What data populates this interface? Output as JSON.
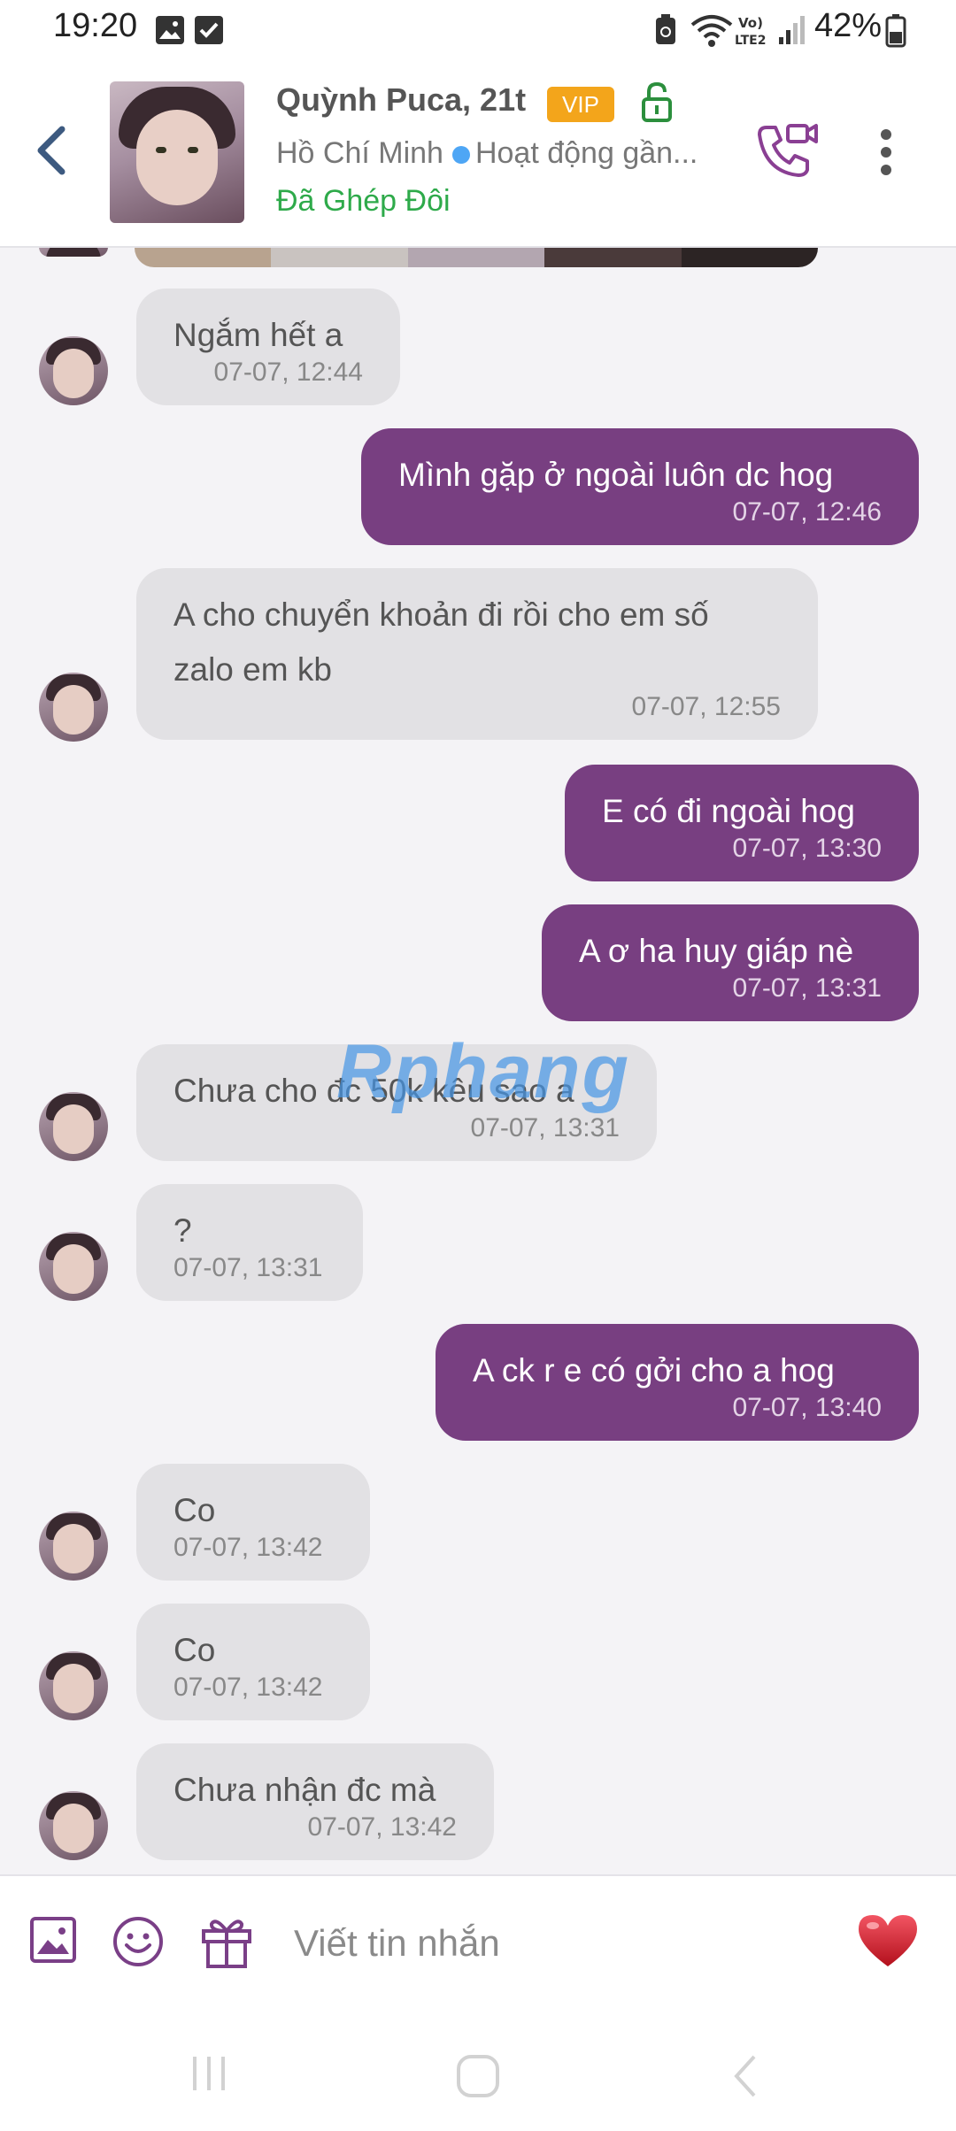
{
  "status_bar": {
    "time": "19:20",
    "battery": "42%",
    "icons": [
      "image-icon",
      "checkbox-icon",
      "recycle-icon",
      "wifi-icon",
      "volte-icon",
      "signal-icon",
      "battery-icon"
    ]
  },
  "header": {
    "name": "Quỳnh Puca, 21t",
    "badge": "VIP",
    "location": "Hồ Chí Minh",
    "activity": "Hoạt động gần...",
    "match_status": "Đã Ghép Đôi",
    "colors": {
      "accent": "#783f81",
      "vip": "#f3a51b",
      "matched": "#2eaa4a",
      "online": "#4ea6f5"
    }
  },
  "messages": [
    {
      "side": "in",
      "text": "Ngắm hết a",
      "time": "07-07, 12:44"
    },
    {
      "side": "out",
      "text": "Mình gặp ở ngoài luôn dc hog",
      "time": "07-07, 12:46"
    },
    {
      "side": "in",
      "text": "A cho chuyển khoản đi rồi cho em số\nzalo em kb",
      "time": "07-07, 12:55"
    },
    {
      "side": "out",
      "text": "E có đi ngoài hog",
      "time": "07-07, 13:30"
    },
    {
      "side": "out",
      "text": "A ơ ha huy giáp nè",
      "time": "07-07, 13:31"
    },
    {
      "side": "in",
      "text": "Chưa cho đc 50k kêu sao a",
      "time": "07-07, 13:31"
    },
    {
      "side": "in",
      "text": "?",
      "time": "07-07, 13:31"
    },
    {
      "side": "out",
      "text": "A ck r e có gởi cho a hog",
      "time": "07-07, 13:40"
    },
    {
      "side": "in",
      "text": "Co",
      "time": "07-07, 13:42"
    },
    {
      "side": "in",
      "text": "Co",
      "time": "07-07, 13:42"
    },
    {
      "side": "in",
      "text": "Chưa nhận đc mà",
      "time": "07-07, 13:42"
    }
  ],
  "watermark": {
    "part1": "Rphang",
    "part2": ""
  },
  "composer": {
    "placeholder": "Viết tin nhắn",
    "icons": [
      "image-icon",
      "emoji-icon",
      "gift-icon",
      "heart-icon"
    ]
  },
  "nav_bar": {
    "icons": [
      "recents-icon",
      "home-icon",
      "back-icon"
    ]
  }
}
